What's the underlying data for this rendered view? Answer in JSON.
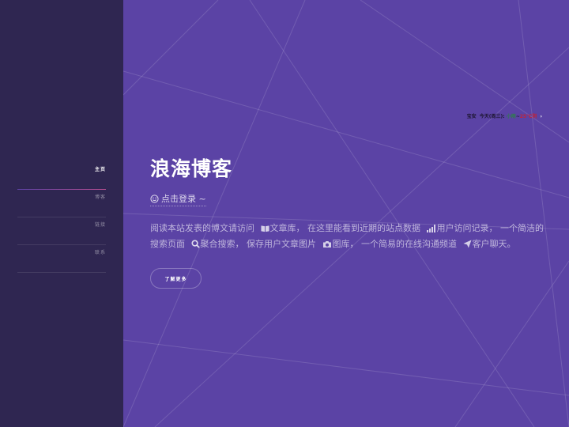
{
  "nav": {
    "items": [
      {
        "label": "主页",
        "active": true
      },
      {
        "label": "博客",
        "active": false
      },
      {
        "label": "链接",
        "active": false
      },
      {
        "label": "联系",
        "active": false
      }
    ]
  },
  "weather": {
    "city": "宝安",
    "day_label": "今天(周三):",
    "condition": "小雨",
    "separator": "~",
    "temperature": "25℃阴"
  },
  "hero": {
    "title": "浪海博客",
    "login_text": "点击登录 ~",
    "description": {
      "part1": "阅读本站发表的博文请访问",
      "link_articles": "文章库",
      "part2": "， 在这里能看到近期的站点数据",
      "link_visits": "用户访问记录",
      "part3": "， 一个简洁的搜索页面",
      "link_search": "聚合搜索",
      "part4": "， 保存用户文章图片",
      "link_gallery": "图库",
      "part5": "， 一个简易的在线沟通频道",
      "link_chat": "客户聊天",
      "part6": "。"
    },
    "more_button": "了解更多"
  },
  "colors": {
    "sidebar_bg": "#2f2651",
    "main_bg": "#5b43a5",
    "accent": "#b74e91"
  }
}
